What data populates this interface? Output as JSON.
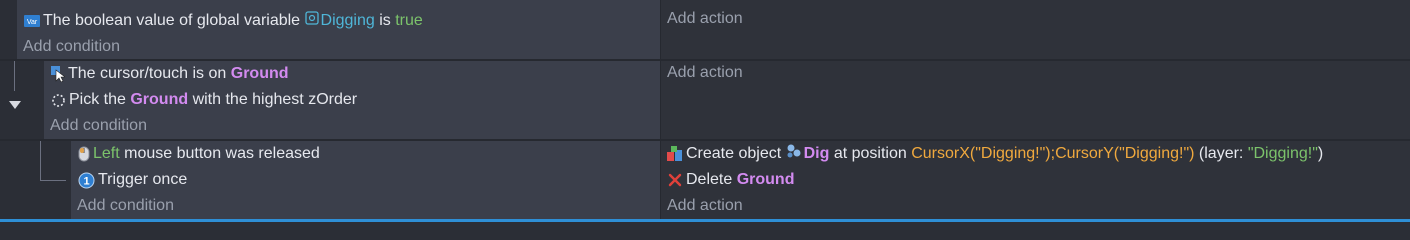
{
  "events": [
    {
      "conditions": [
        {
          "icon": "variable-icon",
          "parts": [
            {
              "text": "The boolean value of global variable ",
              "style": "plain"
            },
            {
              "text": "Digging",
              "style": "cyan"
            },
            {
              "text": " is ",
              "style": "plain"
            },
            {
              "text": "true",
              "style": "green"
            }
          ]
        }
      ],
      "add_condition": "Add condition",
      "actions": [],
      "add_action": "Add action"
    },
    {
      "conditions": [
        {
          "icon": "cursor-on-object-icon",
          "parts": [
            {
              "text": "The cursor/touch is on ",
              "style": "plain"
            },
            {
              "text": "Ground",
              "style": "purple"
            }
          ]
        },
        {
          "icon": "pick-dotted-circle-icon",
          "parts": [
            {
              "text": "Pick the ",
              "style": "plain"
            },
            {
              "text": "Ground",
              "style": "purple"
            },
            {
              "text": " with the highest zOrder",
              "style": "plain"
            }
          ]
        }
      ],
      "add_condition": "Add condition",
      "actions": [],
      "add_action": "Add action"
    },
    {
      "conditions": [
        {
          "icon": "mouse-icon",
          "parts": [
            {
              "text": "Left",
              "style": "green"
            },
            {
              "text": " mouse button was released",
              "style": "plain"
            }
          ]
        },
        {
          "icon": "trigger-once-icon",
          "parts": [
            {
              "text": "Trigger once",
              "style": "plain"
            }
          ]
        }
      ],
      "add_condition": "Add condition",
      "actions": [
        {
          "icon": "create-object-icon",
          "parts": [
            {
              "text": "Create object ",
              "style": "plain"
            },
            {
              "text": "Dig",
              "style": "purple",
              "icon": "dig-object-icon"
            },
            {
              "text": " at position ",
              "style": "plain"
            },
            {
              "text": "CursorX(\"Digging!\");CursorY(\"Digging!\")",
              "style": "orange"
            },
            {
              "text": " (layer: ",
              "style": "plain"
            },
            {
              "text": "\"Digging!\"",
              "style": "green"
            },
            {
              "text": ")",
              "style": "plain"
            }
          ]
        },
        {
          "icon": "delete-icon",
          "parts": [
            {
              "text": "Delete ",
              "style": "plain"
            },
            {
              "text": "Ground",
              "style": "purple"
            }
          ]
        }
      ],
      "add_action": "Add action"
    }
  ],
  "colors": {
    "accent": "#2e8fd6",
    "object_name": "#d38bf0",
    "variable_name": "#4fb6d8",
    "value_green": "#7cc36b",
    "expression_orange": "#f0a93e"
  }
}
